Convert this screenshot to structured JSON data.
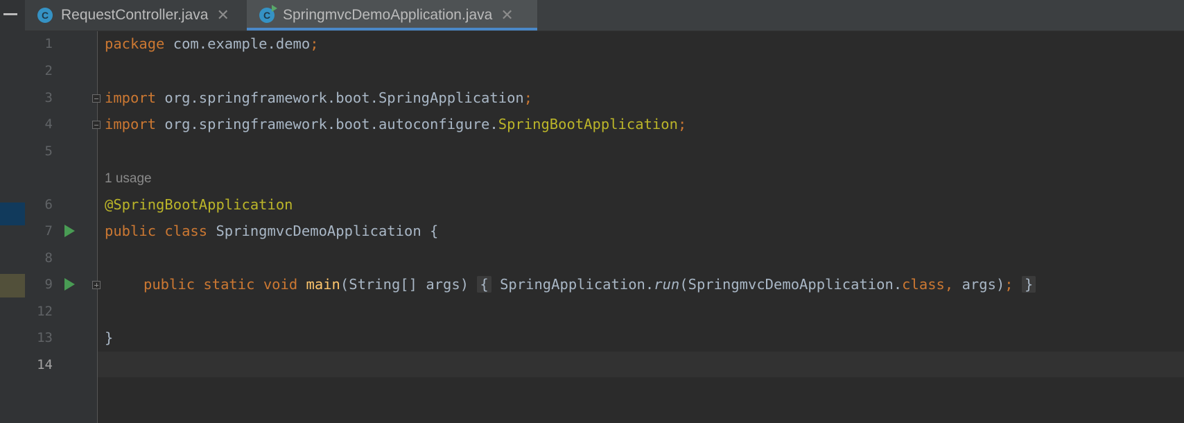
{
  "tabs": [
    {
      "label": "RequestController.java",
      "icon": "java-class-icon",
      "active": false
    },
    {
      "label": "SpringmvcDemoApplication.java",
      "icon": "java-runnable-class-icon",
      "active": true
    }
  ],
  "icons": {
    "class_letter": "C",
    "close": "✕"
  },
  "colors": {
    "keyword": "#cc7832",
    "annotation": "#bbb529",
    "method": "#ffc66d",
    "text": "#a9b7c6",
    "active_tab_underline": "#4a88c7",
    "run_icon": "#499c54"
  },
  "editor": {
    "usage_hint": "1 usage",
    "line_numbers": [
      "1",
      "2",
      "3",
      "4",
      "5",
      "6",
      "7",
      "8",
      "9",
      "12",
      "13",
      "14"
    ],
    "current_line": "14",
    "lines": {
      "l1": {
        "kw": "package",
        "rest": " com.example.demo",
        "semi": ";"
      },
      "l3": {
        "kw": "import",
        "rest": " org.springframework.boot.SpringApplication",
        "semi": ";"
      },
      "l4": {
        "kw": "import",
        "rest": " org.springframework.boot.autoconfigure.",
        "ann": "SpringBootApplication",
        "semi": ";"
      },
      "l6": {
        "ann": "@SpringBootApplication"
      },
      "l7": {
        "kw1": "public",
        "kw2": "class",
        "rest": " SpringmvcDemoApplication {"
      },
      "l9": {
        "kw1": "public",
        "kw2": "static",
        "kw3": "void",
        "fn": "main",
        "params": "(String[] args)",
        "brace_open": "{",
        "call_obj": " SpringApplication.",
        "call_fn": "run",
        "call_args_a": "(SpringmvcDemoApplication.",
        "class_kw": "class",
        "comma": ",",
        "call_args_b": " args)",
        "semi": ";",
        "brace_close": "}"
      },
      "l13": {
        "text": "}"
      }
    }
  }
}
